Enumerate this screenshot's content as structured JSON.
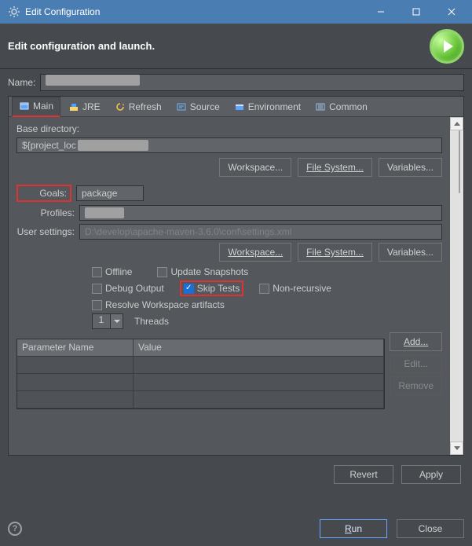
{
  "window": {
    "title": "Edit Configuration"
  },
  "header": {
    "text": "Edit configuration and launch."
  },
  "name": {
    "label": "Name:",
    "value": ""
  },
  "tabs": {
    "main": "Main",
    "jre": "JRE",
    "refresh": "Refresh",
    "source": "Source",
    "environment": "Environment",
    "common": "Common"
  },
  "baseDir": {
    "label": "Base directory:",
    "value": "${project_loc",
    "workspace": "Workspace...",
    "filesystem": "File System...",
    "variables": "Variables..."
  },
  "goals": {
    "label": "Goals:",
    "value": "package"
  },
  "profiles": {
    "label": "Profiles:",
    "value": ""
  },
  "userSettings": {
    "label": "User settings:",
    "value": "D:\\develop\\apache-maven-3.6.0\\conf\\settings.xml",
    "workspace": "Workspace...",
    "filesystem": "File System...",
    "variables": "Variables..."
  },
  "checks": {
    "offline": "Offline",
    "updateSnapshots": "Update Snapshots",
    "debugOutput": "Debug Output",
    "skipTests": "Skip Tests",
    "nonRecursive": "Non-recursive",
    "resolveWorkspace": "Resolve Workspace artifacts"
  },
  "threads": {
    "label": "Threads",
    "value": "1"
  },
  "table": {
    "colParam": "Parameter Name",
    "colValue": "Value",
    "add": "Add...",
    "edit": "Edit...",
    "remove": "Remove"
  },
  "footer": {
    "revert": "Revert",
    "apply": "Apply"
  },
  "bottom": {
    "run": "Run",
    "close": "Close"
  }
}
